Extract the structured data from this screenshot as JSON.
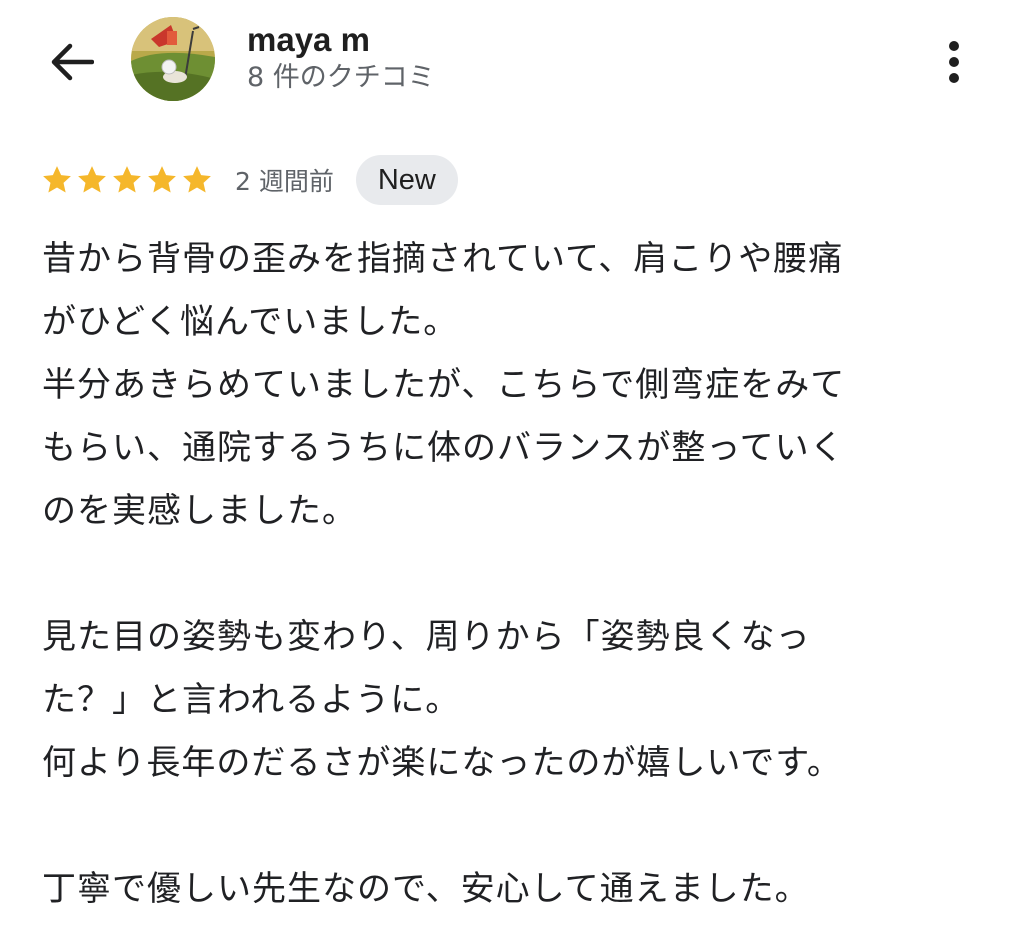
{
  "header": {
    "user_name": "maya m",
    "review_count": "8 件のクチコミ",
    "back_icon": "arrow-left-icon",
    "more_icon": "more-vert-icon"
  },
  "review": {
    "rating": 5,
    "max_rating": 5,
    "time_ago": "2 週間前",
    "badge": "New",
    "star_color": "#f5b72b",
    "lines": [
      "昔から背骨の歪みを指摘されていて、肩こりや腰痛",
      "がひどく悩んでいました。",
      "半分あきらめていましたが、こちらで側弯症をみて",
      "もらい、通院するうちに体のバランスが整っていく",
      "のを実感しました。",
      "",
      "見た目の姿勢も変わり、周りから「姿勢良くなっ",
      "た？」と言われるように。",
      "何より長年のだるさが楽になったのが嬉しいです。",
      "",
      "丁寧で優しい先生なので、安心して通えました。"
    ]
  }
}
